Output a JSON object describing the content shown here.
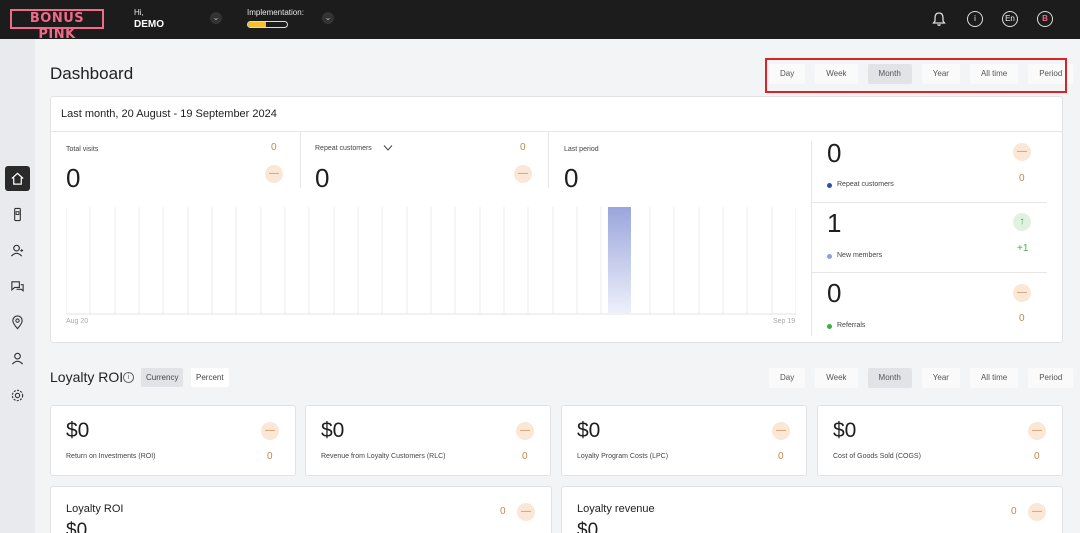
{
  "header": {
    "logo": "BONUS PINK",
    "greeting": "Hi,",
    "user": "DEMO",
    "implementation_label": "Implementation:",
    "implementation_progress": 0.45,
    "language": "En",
    "avatar_initial": "B"
  },
  "sidebar": {
    "items": [
      "home-icon",
      "mobile-card-icon",
      "customers-icon",
      "messages-icon",
      "location-icon",
      "user-icon",
      "gear-icon"
    ]
  },
  "dashboard": {
    "title": "Dashboard",
    "period_tabs": [
      "Day",
      "Week",
      "Month",
      "Year",
      "All time",
      "Period"
    ],
    "active_tab": "Month",
    "range_title": "Last month, 20 August - 19 September 2024",
    "metrics": {
      "total_visits": {
        "label": "Total visits",
        "value": "0",
        "delta": "0"
      },
      "repeat_customers": {
        "label": "Repeat customers",
        "value": "0",
        "delta": "0"
      },
      "last_period": {
        "label": "Last period",
        "value": "0"
      }
    },
    "side_stats": [
      {
        "value": "0",
        "label": "Repeat customers",
        "delta": "0",
        "color": "#2f4fb3"
      },
      {
        "value": "1",
        "label": "New members",
        "delta": "+1",
        "color": "#8f9fe0"
      },
      {
        "value": "0",
        "label": "Referrals",
        "delta": "0",
        "color": "#3cb043"
      }
    ],
    "chart_start": "Aug 20",
    "chart_end": "Sep 19"
  },
  "chart_data": {
    "type": "bar",
    "categories": [
      "Aug 20",
      "Sep 19"
    ],
    "values": [
      0,
      0
    ],
    "xlabel": "",
    "ylabel": ""
  },
  "roi": {
    "title": "Loyalty ROI",
    "toggle": [
      "Currency",
      "Percent"
    ],
    "active_toggle": "Currency",
    "period_tabs": [
      "Day",
      "Week",
      "Month",
      "Year",
      "All time",
      "Period"
    ],
    "active_tab": "Month",
    "cards": [
      {
        "value": "$0",
        "label": "Return on Investments (ROI)",
        "delta": "0"
      },
      {
        "value": "$0",
        "label": "Revenue from Loyalty Customers (RLC)",
        "delta": "0"
      },
      {
        "value": "$0",
        "label": "Loyalty Program Costs (LPC)",
        "delta": "0"
      },
      {
        "value": "$0",
        "label": "Cost of Goods Sold (COGS)",
        "delta": "0"
      }
    ],
    "bottom_cards": [
      {
        "title": "Loyalty ROI",
        "delta": "0",
        "value": "$0"
      },
      {
        "title": "Loyalty revenue",
        "delta": "0",
        "value": "$0"
      }
    ]
  }
}
